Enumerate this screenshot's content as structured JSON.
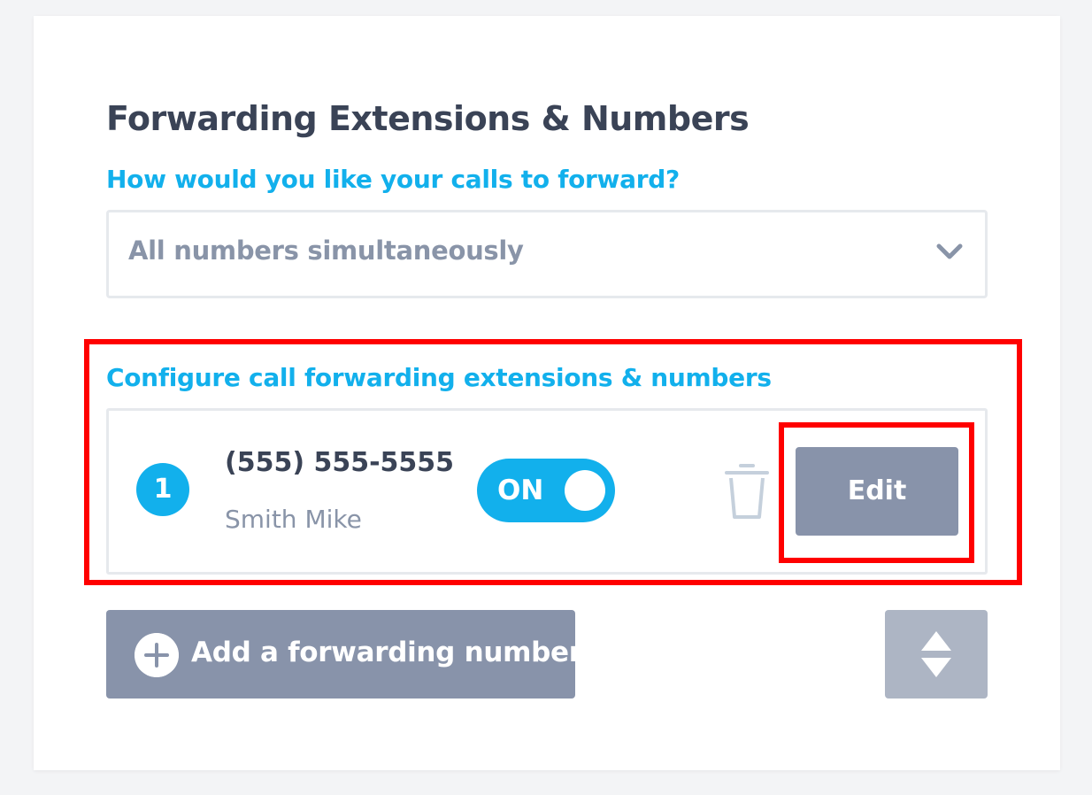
{
  "page": {
    "title": "Forwarding Extensions & Numbers"
  },
  "forward_mode": {
    "label": "How would you like your calls to forward?",
    "selected": "All numbers simultaneously"
  },
  "config": {
    "label": "Configure call forwarding extensions & numbers",
    "entries": [
      {
        "index": "1",
        "number": "(555) 555-5555",
        "name": "Smith Mike",
        "toggle_label": "ON",
        "enabled": true,
        "edit_label": "Edit"
      }
    ]
  },
  "actions": {
    "add_label": "Add a forwarding number"
  },
  "icons": {
    "chevron": "chevron-down-icon",
    "trash": "trash-icon",
    "add": "plus-circle-icon",
    "sort": "sort-icon"
  },
  "colors": {
    "accent": "#12b0ec",
    "title": "#3a4356",
    "muted": "#8994a8",
    "button": "#8893aa",
    "button_disabled": "#adb5c4",
    "highlight": "#ff0000"
  }
}
